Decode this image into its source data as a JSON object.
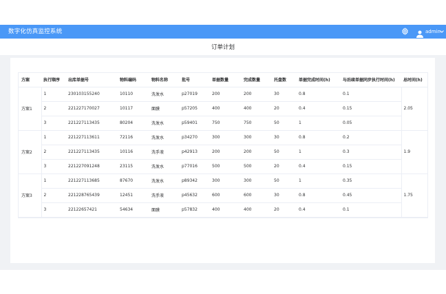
{
  "app": {
    "brand": "数字化仿真监控系统",
    "user": "admin",
    "settings_icon": "gear-icon",
    "user_icon": "user-icon"
  },
  "page": {
    "title": "订单计划"
  },
  "table": {
    "columns": [
      "方案",
      "执行顺序",
      "出库单据号",
      "物料编码",
      "物料名称",
      "批号",
      "单据数量",
      "完成数量",
      "托盘数",
      "单据完成时间(h)",
      "与后续单据同步执行时间(h)",
      "总时间(h)"
    ],
    "groups": [
      {
        "plan": "方案1",
        "total": "2.05",
        "rows": [
          [
            "1",
            "230103155240",
            "10110",
            "洗发水",
            "p27019",
            "200",
            "200",
            "30",
            "0.8",
            "0.1"
          ],
          [
            "2",
            "221227170027",
            "10117",
            "面膜",
            "p57205",
            "400",
            "400",
            "20",
            "0.4",
            "0.15"
          ],
          [
            "3",
            "221227113435",
            "80204",
            "洗发水",
            "p59401",
            "750",
            "750",
            "50",
            "1",
            "0.05"
          ]
        ]
      },
      {
        "plan": "方案2",
        "total": "1.9",
        "rows": [
          [
            "1",
            "221227113611",
            "72116",
            "洗发水",
            "p34270",
            "300",
            "300",
            "30",
            "0.8",
            "0.2"
          ],
          [
            "2",
            "221227113435",
            "10116",
            "洗手液",
            "p42913",
            "200",
            "200",
            "50",
            "1",
            "0.3"
          ],
          [
            "3",
            "221227091248",
            "23115",
            "洗发水",
            "p77016",
            "500",
            "500",
            "20",
            "0.4",
            "0.15"
          ]
        ]
      },
      {
        "plan": "方案3",
        "total": "1.75",
        "rows": [
          [
            "1",
            "221227113685",
            "87670",
            "洗发水",
            "p89342",
            "300",
            "300",
            "50",
            "1",
            "0.35"
          ],
          [
            "2",
            "221228765439",
            "12451",
            "洗手液",
            "p45632",
            "600",
            "600",
            "30",
            "0.8",
            "0.45"
          ],
          [
            "3",
            "22122657421",
            "54634",
            "面膜",
            "p57832",
            "400",
            "400",
            "20",
            "0.4",
            "0.1"
          ]
        ]
      }
    ]
  },
  "colors": {
    "navbar": "#4a98f7",
    "content_bg": "#f0f2f5",
    "border": "#ebeef5"
  }
}
